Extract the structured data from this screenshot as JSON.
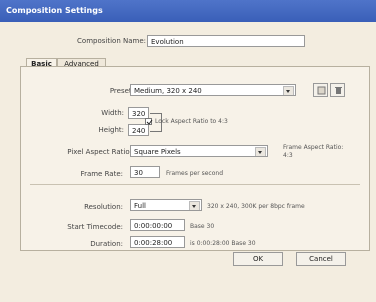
{
  "window": {
    "title": "Composition Settings"
  },
  "composition": {
    "name_label": "Composition Name:",
    "name_value": "Evolution"
  },
  "tabs": [
    {
      "label": "Basic"
    },
    {
      "label": "Advanced"
    }
  ],
  "basic": {
    "preset": {
      "label": "Preset:",
      "value": "Medium, 320 x 240"
    },
    "width": {
      "label": "Width:",
      "value": "320"
    },
    "height": {
      "label": "Height:",
      "value": "240"
    },
    "lock_aspect": {
      "label": "Lock Aspect Ratio to 4:3",
      "checked": true
    },
    "pixel_aspect": {
      "label": "Pixel Aspect Ratio:",
      "value": "Square Pixels"
    },
    "frame_aspect": {
      "label": "Frame Aspect Ratio:",
      "value": "4:3"
    },
    "frame_rate": {
      "label": "Frame Rate:",
      "value": "30",
      "unit": "Frames per second"
    },
    "resolution": {
      "label": "Resolution:",
      "value": "Full",
      "info": "320 x 240, 300K per 8bpc frame"
    },
    "start_timecode": {
      "label": "Start Timecode:",
      "value": "0:00:00:00",
      "base": "Base 30"
    },
    "duration": {
      "label": "Duration:",
      "value": "0:00:28:00",
      "info": "is 0:00:28:00 Base 30"
    }
  },
  "buttons": {
    "ok": "OK",
    "cancel": "Cancel"
  },
  "icons": {
    "preset_save": "save-preset-icon",
    "preset_delete": "delete-preset-icon"
  },
  "colors": {
    "titlebar": "#3a5fb8",
    "background": "#f3ede0"
  }
}
